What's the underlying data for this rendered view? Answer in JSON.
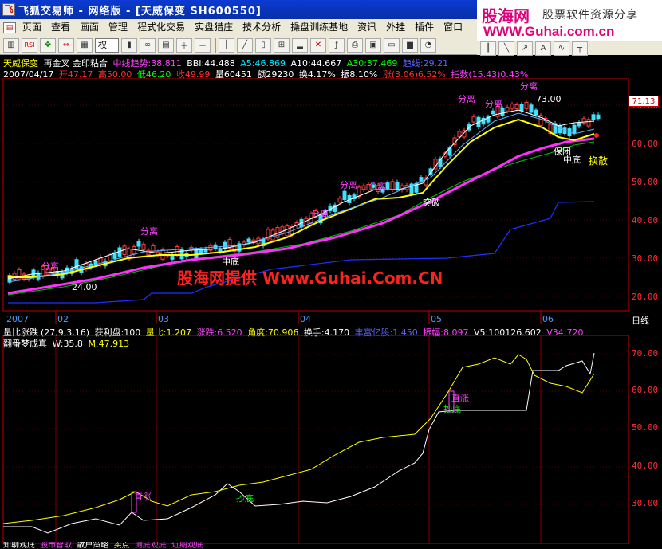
{
  "window": {
    "title": "飞狐交易师 - 网络版 - [天威保变 SH600550]"
  },
  "logo": {
    "main": "股海网",
    "sub": "股票软件资源分享",
    "url": "WWW.Guhai.com.cn"
  },
  "menu": {
    "items": [
      "页面",
      "查看",
      "画面",
      "管理",
      "程式化交易",
      "实盘猎庄",
      "技术分析",
      "操盘训练基地",
      "资讯",
      "外挂",
      "插件",
      "窗口"
    ]
  },
  "toolbar": {
    "quan": "权",
    "rsi": "RSI"
  },
  "chart_header": {
    "stock_name": "天威保变",
    "indicator": "再金叉 金印粘合",
    "trend": "中线趋势:38.811",
    "bbi": "BBI:44.488",
    "a5": "A5:46.869",
    "a10": "A10:44.667",
    "a30": "A30:37.469",
    "trend_line": "趋线:29.21"
  },
  "quote_line": {
    "date": "2007/04/17",
    "open": "开47.17",
    "high": "高50.00",
    "low": "低46.20",
    "close": "收49.99",
    "volume": "量60451",
    "amount": "额29230",
    "turnover": "换4.17%",
    "amplitude": "振8.10%",
    "change": "涨(3.06)6.52%",
    "index": "指数(15.43)0.43%"
  },
  "price_axis": {
    "labels": [
      "70.00",
      "60.00",
      "50.00",
      "40.00",
      "30.00",
      "20.00"
    ],
    "current_tag": "71.13",
    "period": "日线"
  },
  "time_axis": {
    "labels": [
      "2007",
      "02",
      "03",
      "04",
      "05",
      "06"
    ]
  },
  "annotations": {
    "fenli": "分离",
    "high_label": "73.00",
    "low_label": "24.00",
    "zhongdi": "中底",
    "tupo": "突破",
    "hanwen": "保团",
    "hanwen2": "中底",
    "huanli": "换散"
  },
  "watermark": "股海网提供 Www.Guhai.Com.CN",
  "indicator1": {
    "name": "量比涨跌",
    "params": "(27,9,3,16)",
    "profit": "获利盘:100",
    "vol_ratio": "量比:1.207",
    "change": "涨跌:6.520",
    "angle": "角度:70.906",
    "turnover": "换手:4.170",
    "market_cap": "丰富亿股:1.450",
    "amplitude": "振幅:8.097",
    "v5": "V5:100126.602",
    "v34": "V34:720"
  },
  "indicator2": {
    "name": "翻番梦成真",
    "w": "W:35.8",
    "m": "M:47.913"
  },
  "sub_axis": {
    "labels": [
      "70.00",
      "60.00",
      "50.00",
      "40.00",
      "30.00"
    ]
  },
  "sub_annotations": {
    "zhizhang": "直涨",
    "chaodi": "抄底",
    "zhizhang2": "直涨",
    "chaodi2": "抄底"
  },
  "bottom_strip": {
    "text1": "知聊观底",
    "text2": "股市智取",
    "text3": "散户策略",
    "text4": "卖点",
    "text5": "测底观底",
    "text6": "近期观底"
  }
}
